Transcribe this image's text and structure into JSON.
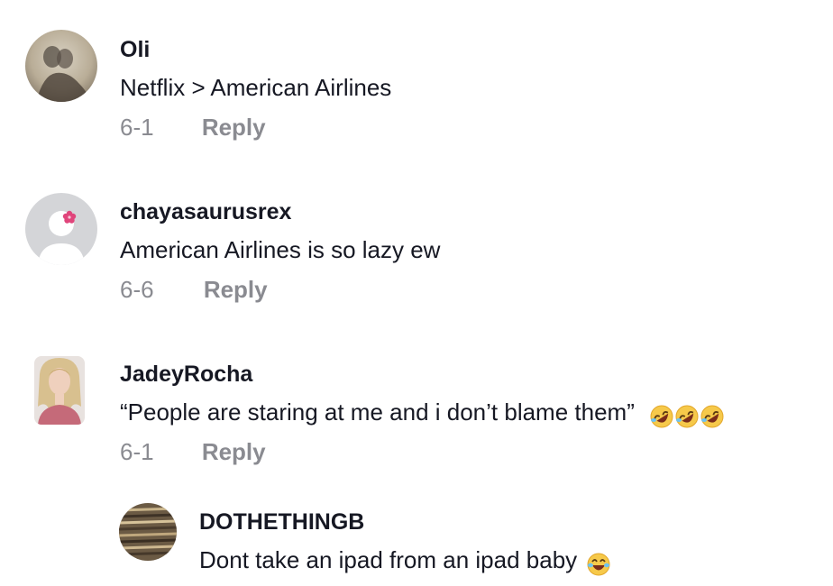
{
  "comments": [
    {
      "username": "Oli",
      "text": "Netflix > American Airlines",
      "date": "6-1",
      "reply_label": "Reply"
    },
    {
      "username": "chayasaurusrex",
      "text": "American Airlines is so lazy ew",
      "date": "6-6",
      "reply_label": "Reply"
    },
    {
      "username": "JadeyRocha",
      "text": "“People are staring at me and i don’t blame them”",
      "date": "6-1",
      "reply_label": "Reply",
      "emoji": "rolling-on-floor-laughing x3"
    },
    {
      "username": "DOTHETHINGB",
      "text": "Dont take an ipad from an ipad baby",
      "emoji": "face-with-tears-of-joy"
    }
  ]
}
